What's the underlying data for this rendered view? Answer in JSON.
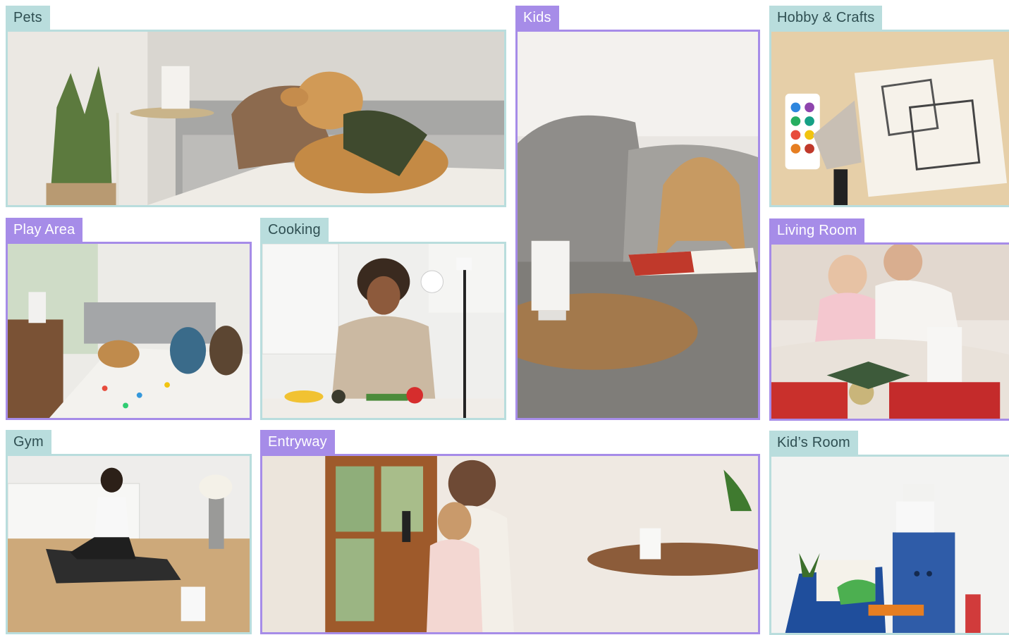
{
  "tiles": [
    {
      "id": "pets",
      "label": "Pets",
      "theme": "teal"
    },
    {
      "id": "kids",
      "label": "Kids",
      "theme": "purple"
    },
    {
      "id": "hobby-crafts",
      "label": "Hobby & Crafts",
      "theme": "teal"
    },
    {
      "id": "play-area",
      "label": "Play Area",
      "theme": "purple"
    },
    {
      "id": "cooking",
      "label": "Cooking",
      "theme": "teal"
    },
    {
      "id": "living-room",
      "label": "Living Room",
      "theme": "purple"
    },
    {
      "id": "gym",
      "label": "Gym",
      "theme": "teal"
    },
    {
      "id": "entryway",
      "label": "Entryway",
      "theme": "purple"
    },
    {
      "id": "kids-room",
      "label": "Kid’s Room",
      "theme": "teal"
    }
  ],
  "colors": {
    "teal": "#b9dddd",
    "purple": "#a68ce8",
    "teal_text": "#2f4f52"
  }
}
